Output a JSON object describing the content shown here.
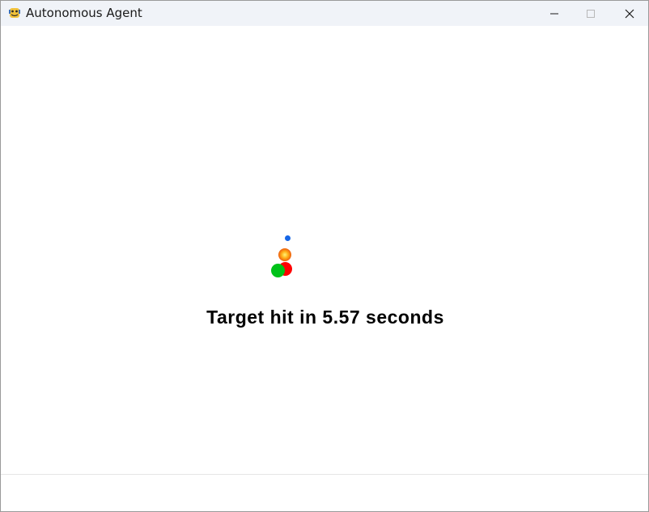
{
  "window": {
    "title": "Autonomous Agent",
    "app_icon": "python-snake-icon",
    "controls": {
      "minimize": "minimize-icon",
      "maximize": "maximize-icon",
      "close": "close-icon"
    }
  },
  "game": {
    "status_text": "Target hit in 5.57 seconds",
    "colors": {
      "agent": "#00c219",
      "target": "#ff0000",
      "projectile": "#1666e6",
      "explosion": "#f06a10"
    }
  }
}
